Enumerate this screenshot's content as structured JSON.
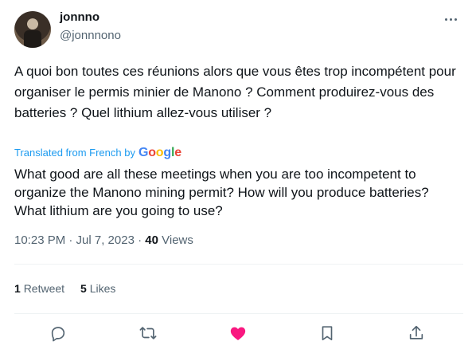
{
  "author": {
    "display_name": "jonnno",
    "handle": "@jonnnono"
  },
  "tweet": {
    "original_text": "A quoi bon toutes ces réunions alors que vous êtes trop incompétent pour organiser le permis minier de Manono ? Comment produirez-vous des batteries ? Quel lithium allez-vous utiliser ?",
    "translated_label": "Translated from French by",
    "translation_provider": "Google",
    "translated_text": "What good are all these meetings when you are too incompetent to organize the Manono mining permit? How will you produce batteries? What lithium are you going to use?"
  },
  "meta": {
    "time_date": "10:23 PM · Jul 7, 2023 · ",
    "views_count": "40",
    "views_label": "Views"
  },
  "stats": {
    "retweets_count": "1",
    "retweets_label": "Retweet",
    "likes_count": "5",
    "likes_label": "Likes"
  },
  "actions": {
    "icons": [
      "reply-icon",
      "retweet-icon",
      "like-icon",
      "bookmark-icon",
      "share-icon"
    ],
    "liked_color": "#f91880"
  },
  "colors": {
    "text": "#0f1419",
    "secondary": "#536471",
    "link": "#1d9bf0"
  }
}
